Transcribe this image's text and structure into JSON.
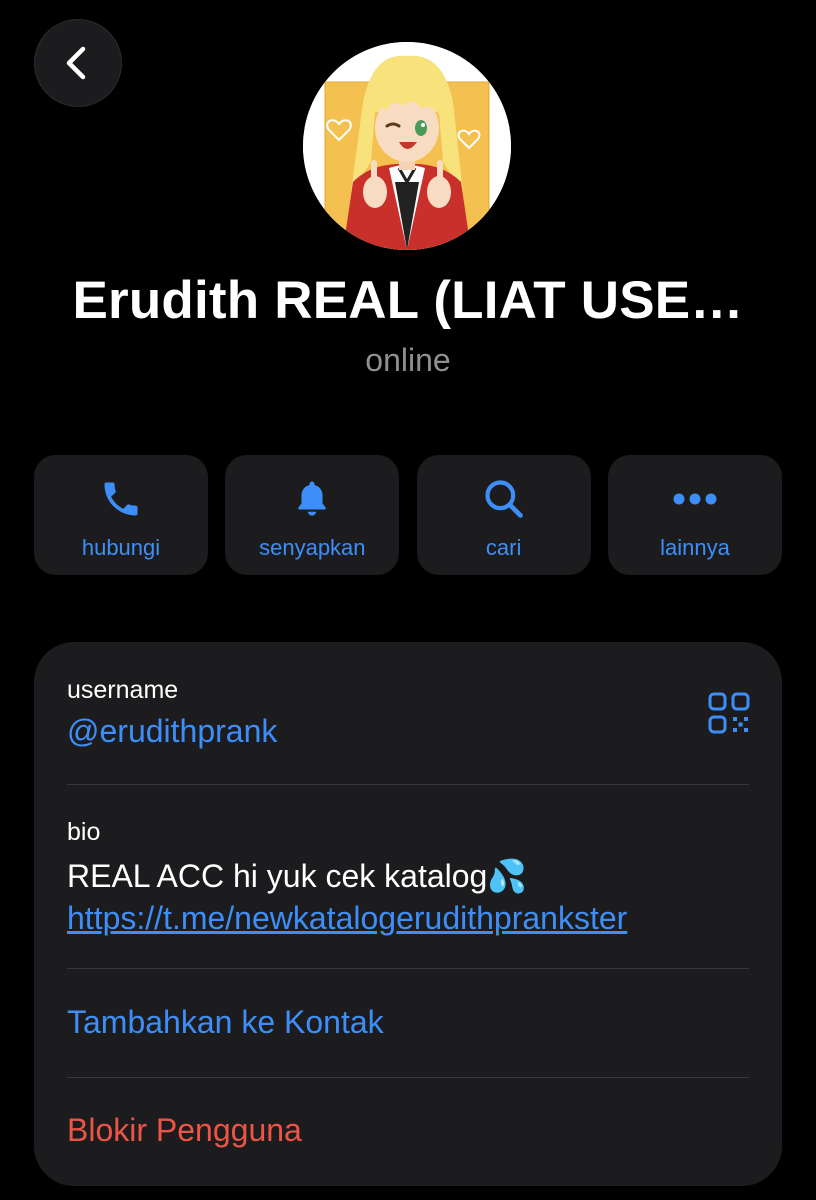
{
  "header": {
    "name": "Erudith REAL (LIAT USE…",
    "status": "online"
  },
  "actions": [
    {
      "label": "hubungi",
      "icon": "phone-icon"
    },
    {
      "label": "senyapkan",
      "icon": "bell-icon"
    },
    {
      "label": "cari",
      "icon": "search-icon"
    },
    {
      "label": "lainnya",
      "icon": "more-icon"
    }
  ],
  "info": {
    "username_label": "username",
    "username_value": "@erudithprank",
    "bio_label": "bio",
    "bio_text": "REAL ACC hi yuk cek katalog",
    "bio_emoji": "💦",
    "bio_link": "https://t.me/newkatalogerudithprankster",
    "add_contact": "Tambahkan ke Kontak",
    "block_user": "Blokir Pengguna"
  },
  "colors": {
    "accent": "#3d8ef7",
    "danger": "#eb5545",
    "card": "#1c1c1e",
    "secondary_text": "#8e8e93"
  }
}
